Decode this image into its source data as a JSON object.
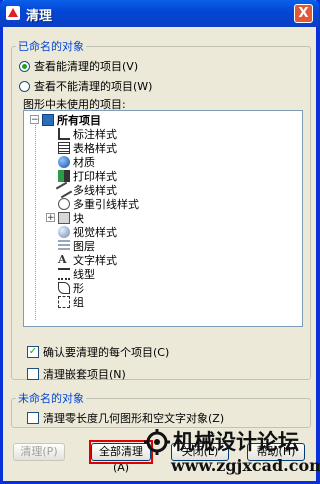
{
  "window": {
    "title": "清理",
    "close_label": "X"
  },
  "named_group": {
    "legend": "已命名的对象",
    "radio_view_purgeable": "查看能清理的项目(V)",
    "radio_view_nonpurgeable": "查看不能清理的项目(W)",
    "unused_label": "图形中未使用的项目:"
  },
  "tree": {
    "root": "所有项目",
    "items": [
      "标注样式",
      "表格样式",
      "材质",
      "打印样式",
      "多线样式",
      "多重引线样式",
      "块",
      "视觉样式",
      "图层",
      "文字样式",
      "线型",
      "形",
      "组"
    ]
  },
  "options": {
    "confirm_each": "确认要清理的每个项目(C)",
    "confirm_checked": true,
    "purge_nested": "清理嵌套项目(N)",
    "nested_checked": false
  },
  "unnamed_group": {
    "legend": "未命名的对象",
    "purge_zero": "清理零长度几何图形和空文字对象(Z)",
    "zero_checked": false
  },
  "buttons": {
    "purge": "清理(P)",
    "purge_all": "全部清理(A)",
    "close": "关闭(L)",
    "help": "帮助(H)"
  },
  "watermark": {
    "line1": "机械设计论坛",
    "line2": "www.zgjxcad.com"
  }
}
